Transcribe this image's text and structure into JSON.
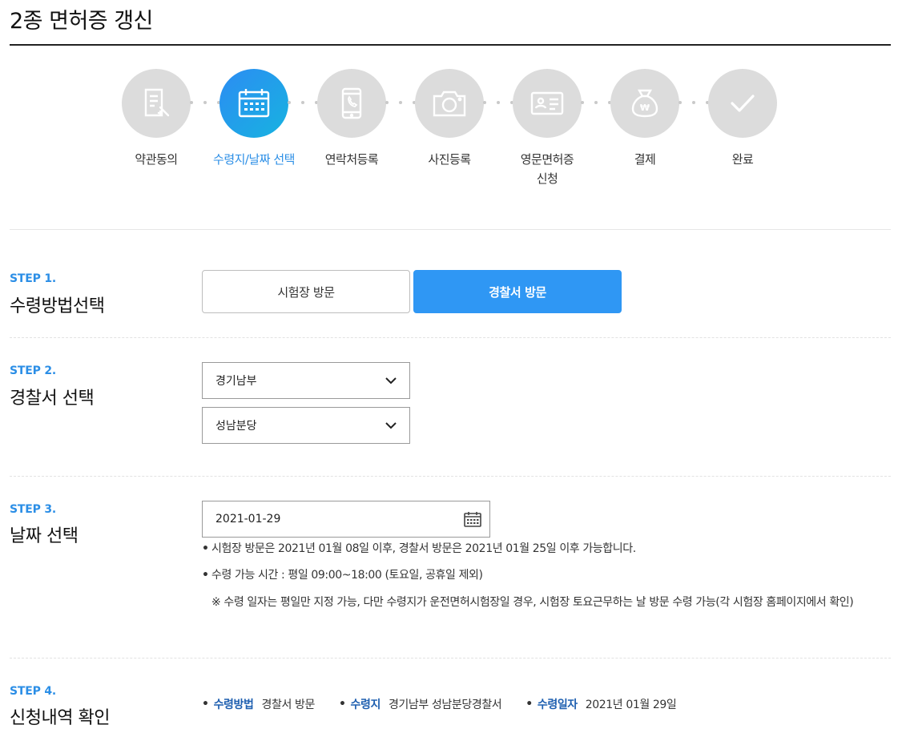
{
  "page": {
    "title": "2종 면허증 갱신"
  },
  "steps": [
    {
      "label": "약관동의",
      "icon": "document-sign-icon",
      "active": false
    },
    {
      "label": "수령지/날짜 선택",
      "icon": "calendar-icon",
      "active": true
    },
    {
      "label": "연락처등록",
      "icon": "phone-icon",
      "active": false
    },
    {
      "label": "사진등록",
      "icon": "camera-icon",
      "active": false
    },
    {
      "label": "영문면허증\n신청",
      "label_line1": "영문면허증",
      "label_line2": "신청",
      "icon": "id-card-icon",
      "active": false
    },
    {
      "label": "결제",
      "icon": "money-bag-icon",
      "active": false
    },
    {
      "label": "완료",
      "icon": "check-icon",
      "active": false
    }
  ],
  "step1": {
    "no": "STEP 1.",
    "title": "수령방법선택",
    "options": [
      "시험장 방문",
      "경찰서 방문"
    ],
    "selected": "경찰서 방문"
  },
  "step2": {
    "no": "STEP 2.",
    "title": "경찰서 선택",
    "region": "경기남부",
    "station": "성남분당"
  },
  "step3": {
    "no": "STEP 3.",
    "title": "날짜 선택",
    "date": "2021-01-29",
    "notes": [
      "시험장 방문은 2021년 01월 08일 이후, 경찰서 방문은 2021년 01월 25일 이후 가능합니다.",
      "수령 가능 시간 : 평일 09:00~18:00 (토요일, 공휴일 제외)"
    ],
    "sub_note": "※ 수령 일자는 평일만 지정 가능, 다만 수령지가 운전면허시험장일 경우, 시험장 토요근무하는 날 방문 수령 가능(각 시험장 홈페이지에서 확인)"
  },
  "step4": {
    "no": "STEP 4.",
    "title": "신청내역 확인",
    "summary": [
      {
        "key": "수령방법",
        "value": "경찰서 방문"
      },
      {
        "key": "수령지",
        "value": "경기남부 성남분당경찰서"
      },
      {
        "key": "수령일자",
        "value": "2021년 01월 29일"
      }
    ]
  },
  "colors": {
    "accent": "#2f97f4",
    "active_step": "#2b8ee6",
    "inactive_circle": "#dcdcdc",
    "summary_key": "#1e5fb0"
  }
}
